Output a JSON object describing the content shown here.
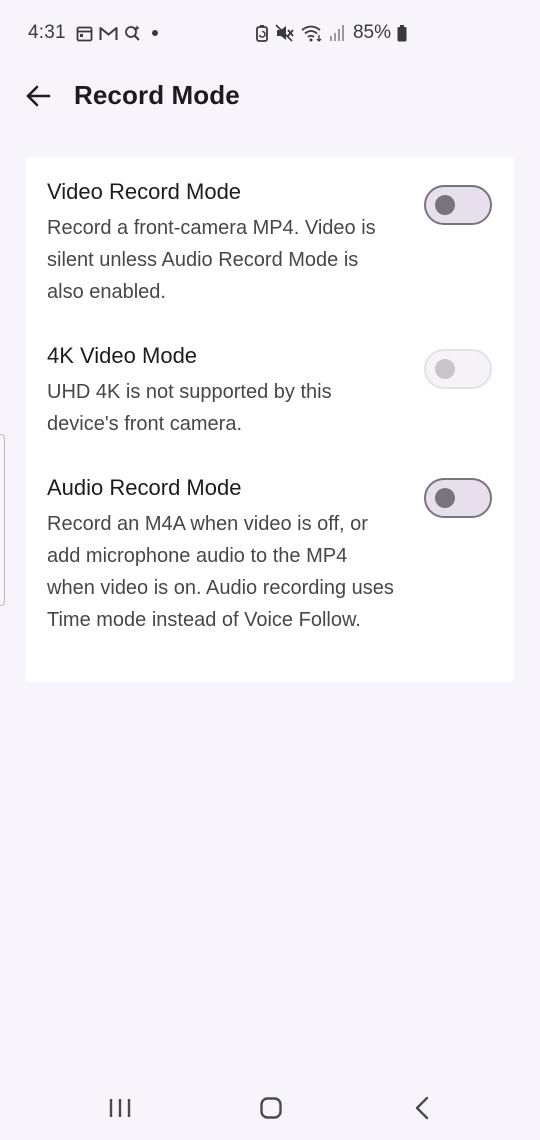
{
  "status_bar": {
    "time": "4:31",
    "battery_percent": "85%",
    "left_icons": [
      "calendar-icon",
      "gmail-icon",
      "search-sparkle-icon",
      "notification-dot-icon"
    ],
    "right_icons": [
      "battery-saver-icon",
      "mute-icon",
      "wifi-icon",
      "signal-icon",
      "battery-icon"
    ]
  },
  "app_bar": {
    "back_icon": "arrow-left-icon",
    "title": "Record Mode"
  },
  "settings": [
    {
      "title": "Video Record Mode",
      "description": "Record a front-camera MP4. Video is silent unless Audio Record Mode is also enabled.",
      "enabled": false,
      "disabled": false
    },
    {
      "title": "4K Video Mode",
      "description": "UHD 4K is not supported by this device's front camera.",
      "enabled": false,
      "disabled": true
    },
    {
      "title": "Audio Record Mode",
      "description": "Record an M4A when video is off, or add microphone audio to the MP4 when video is on. Audio recording uses Time mode instead of Voice Follow.",
      "enabled": false,
      "disabled": false
    }
  ],
  "nav_bar": {
    "icons": [
      "recents-icon",
      "home-icon",
      "back-icon"
    ]
  },
  "colors": {
    "background": "#f7f5fb",
    "card": "#ffffff",
    "toggle_outline": "#78747e",
    "toggle_track": "#e7e0ec",
    "toggle_disabled": "#c8c6ca"
  }
}
